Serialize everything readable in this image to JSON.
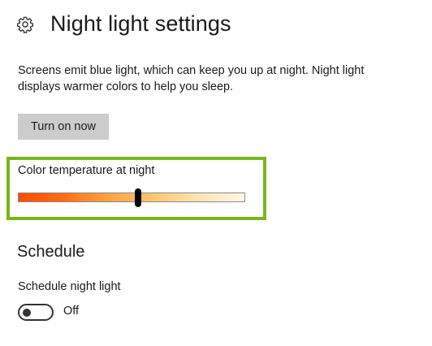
{
  "header": {
    "icon": "gear-icon",
    "title": "Night light settings"
  },
  "description": "Screens emit blue light, which can keep you up at night. Night light displays warmer colors to help you sleep.",
  "turn_on_button": {
    "label": "Turn on now"
  },
  "color_temperature": {
    "label": "Color temperature at night",
    "slider_value": 0.53,
    "highlight_color": "#7cb518",
    "gradient_start_color": "#ff4a00",
    "gradient_end_color": "#fff6e6"
  },
  "schedule": {
    "heading": "Schedule",
    "toggle_label": "Schedule night light",
    "toggle_on": false,
    "toggle_state_text": "Off"
  }
}
